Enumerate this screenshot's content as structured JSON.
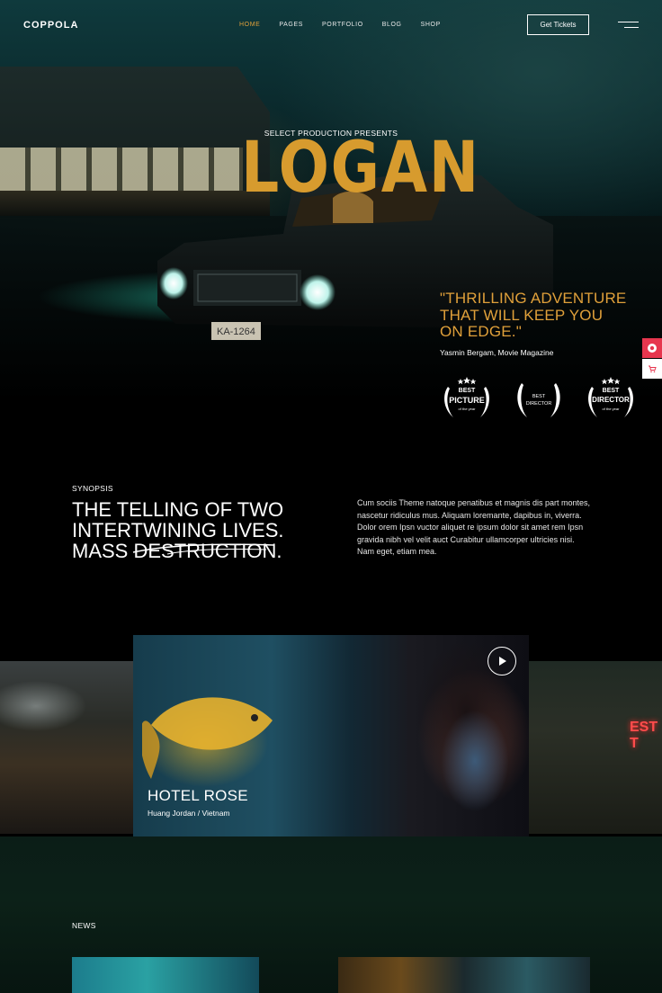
{
  "brand": {
    "logo": "COPPOLA"
  },
  "nav": {
    "items": [
      {
        "label": "HOME",
        "active": true
      },
      {
        "label": "PAGES",
        "active": false
      },
      {
        "label": "PORTFOLIO",
        "active": false
      },
      {
        "label": "BLOG",
        "active": false
      },
      {
        "label": "SHOP",
        "active": false
      }
    ],
    "cta_label": "Get Tickets"
  },
  "hero": {
    "presents": "SELECT PRODUCTION PRESENTS",
    "title": "LOGAN",
    "quote": "\"THRILLING ADVENTURE THAT WILL KEEP YOU ON EDGE.\"",
    "quote_author": "Yasmin Bergam, Movie Magazine",
    "awards": [
      {
        "line1": "BEST",
        "line2": "PICTURE",
        "sub": "of the year"
      },
      {
        "line1": "BEST",
        "line2": "DIRECTOR",
        "sub": ""
      },
      {
        "line1": "BEST",
        "line2": "DIRECTOR",
        "sub": "of the year"
      }
    ]
  },
  "side_buttons": [
    {
      "icon": "lifebuoy-icon",
      "color": "#e7364e"
    },
    {
      "icon": "cart-icon",
      "color": "#ffffff"
    }
  ],
  "synopsis": {
    "label": "SYNOPSIS",
    "heading_line1": "THE TELLING OF TWO",
    "heading_line2": "INTERTWINING LIVES.",
    "heading_line3_a": "MASS ",
    "heading_line3_b": "DESTRUCTION",
    "heading_line3_c": ".",
    "body": "Cum sociis Theme natoque penatibus et magnis dis part montes, nascetur ridiculus mus. Aliquam loremante, dapibus in, viverra. Dolor orem Ipsn vuctor aliquet re ipsum dolor sit amet rem Ipsn gravida nibh vel velit auct Curabitur ullamcorper ultricies nisi. Nam eget, etiam mea."
  },
  "gallery": {
    "active_slide": {
      "title": "HOTEL ROSE",
      "subtitle": "Huang Jordan / Vietnam"
    },
    "right_sign": "EST T"
  },
  "news": {
    "label": "NEWS"
  },
  "colors": {
    "accent": "#e0a03a",
    "title": "#d79b2e",
    "pink": "#e7364e"
  }
}
